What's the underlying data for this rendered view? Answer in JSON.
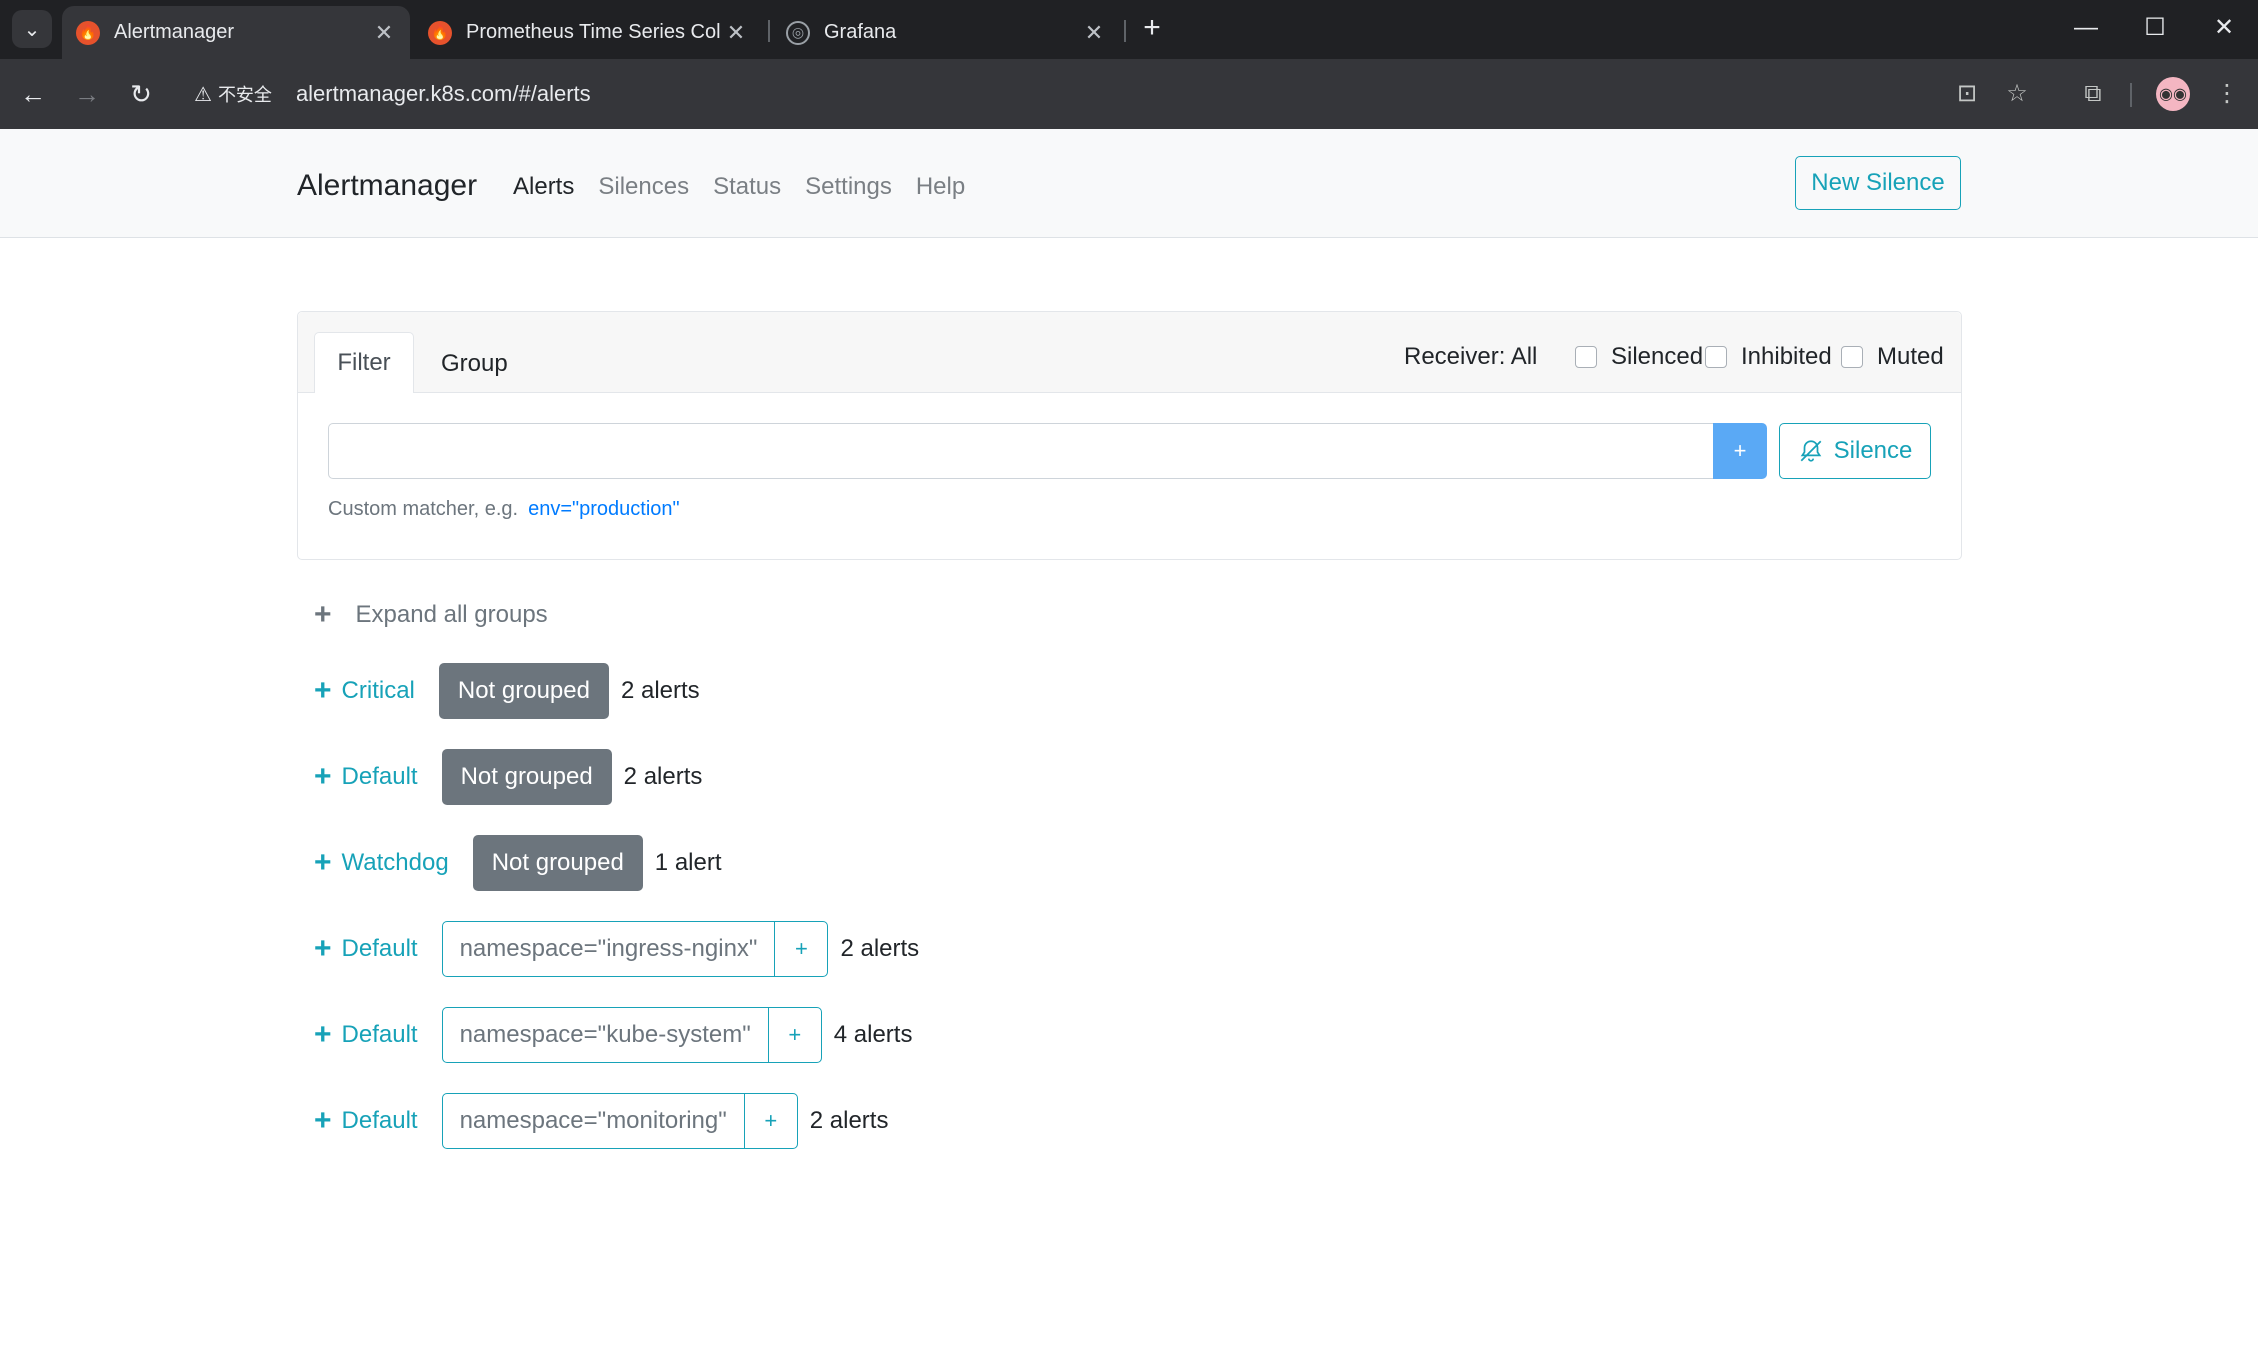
{
  "browser": {
    "tabs": [
      {
        "title": "Alertmanager",
        "active": true
      },
      {
        "title": "Prometheus Time Series Coll",
        "active": false
      },
      {
        "title": "Grafana",
        "active": false
      }
    ],
    "address": {
      "security_label": "不安全",
      "url": "alertmanager.k8s.com/#/alerts"
    }
  },
  "navbar": {
    "brand": "Alertmanager",
    "links": [
      "Alerts",
      "Silences",
      "Status",
      "Settings",
      "Help"
    ],
    "active_link": "Alerts",
    "new_silence_label": "New Silence"
  },
  "filter_card": {
    "tab_filter": "Filter",
    "tab_group": "Group",
    "receiver_label": "Receiver: All",
    "checkboxes": [
      {
        "label": "Silenced",
        "checked": false
      },
      {
        "label": "Inhibited",
        "checked": false
      },
      {
        "label": "Muted",
        "checked": false
      }
    ],
    "input_value": "",
    "add_button": "+",
    "silence_button": "Silence",
    "hint_prefix": "Custom matcher, e.g.",
    "hint_example": "env=\"production\""
  },
  "expand_all_label": "Expand all groups",
  "groups": [
    {
      "receiver": "Critical",
      "label": "Not grouped",
      "count": "2 alerts"
    },
    {
      "receiver": "Default",
      "label": "Not grouped",
      "count": "2 alerts"
    },
    {
      "receiver": "Watchdog",
      "label": "Not grouped",
      "count": "1 alert"
    },
    {
      "receiver": "Default",
      "label": "namespace=\"ingress-nginx\"",
      "count": "2 alerts"
    },
    {
      "receiver": "Default",
      "label": "namespace=\"kube-system\"",
      "count": "4 alerts"
    },
    {
      "receiver": "Default",
      "label": "namespace=\"monitoring\"",
      "count": "2 alerts"
    }
  ],
  "colors": {
    "accent": "#17a2b8",
    "badge": "#6c757d",
    "primary": "#5aa9f5",
    "link": "#007bff"
  }
}
